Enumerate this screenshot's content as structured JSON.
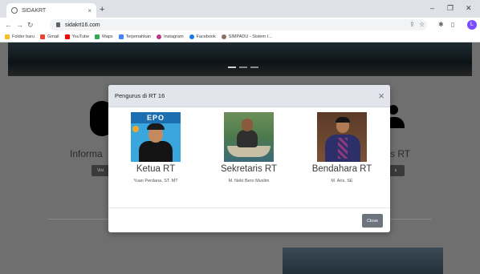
{
  "browser": {
    "tab_title": "SIDAKRT",
    "tab_close": "×",
    "new_tab": "+",
    "url": "sidakrt16.com",
    "win_minimize": "–",
    "win_restore": "❐",
    "win_close": "✕",
    "profile_initial": "L",
    "bookmarks": [
      {
        "label": "Folder baru",
        "color": "#f6bf26"
      },
      {
        "label": "Gmail",
        "color": "#ea4335"
      },
      {
        "label": "YouTube",
        "color": "#ff0000"
      },
      {
        "label": "Maps",
        "color": "#34a853"
      },
      {
        "label": "Terjemahkan",
        "color": "#4285f4"
      },
      {
        "label": "Instagram",
        "color": "#c13584"
      },
      {
        "label": "Facebook",
        "color": "#1877f2"
      },
      {
        "label": "SIMPADU - Sistem I...",
        "color": "#8d6e63"
      }
    ]
  },
  "background": {
    "left_heading": "Informa",
    "right_heading": "s RT",
    "left_button": "Visi",
    "right_button": "s"
  },
  "modal": {
    "title": "Pengurus di RT 16",
    "close_icon": "×",
    "close_button": "Close",
    "photo1_banner": "EPO",
    "members": [
      {
        "role": "Ketua RT",
        "name": "Yuan Perdana, ST. MT"
      },
      {
        "role": "Sekretaris RT",
        "name": "M. Nebi Bero Muslim"
      },
      {
        "role": "Bendahara RT",
        "name": "M. Aris, SE"
      }
    ]
  }
}
